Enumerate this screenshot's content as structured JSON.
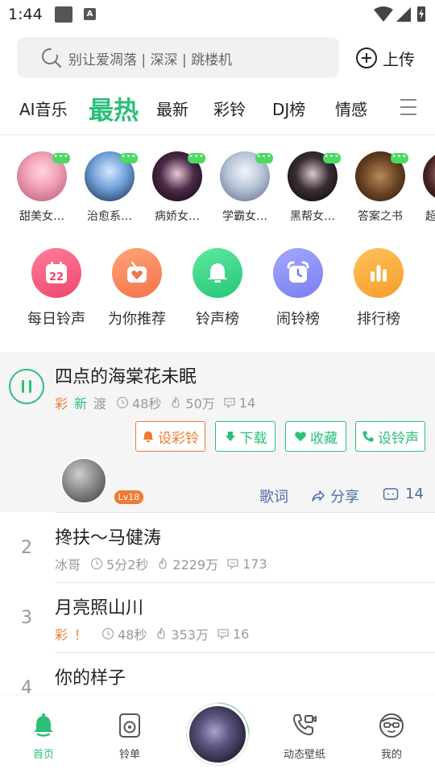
{
  "status_bar": {
    "time": "1:44",
    "a_label": "A"
  },
  "search": {
    "placeholder": "别让爱凋落 | 深深 | 跳楼机",
    "upload_label": "上传"
  },
  "tabs": [
    "AI音乐",
    "最热",
    "最新",
    "彩铃",
    "DJ榜",
    "情感"
  ],
  "active_tab": "最热",
  "avatars": [
    {
      "label": "甜美女…",
      "badge": "•••"
    },
    {
      "label": "治愈系…",
      "badge": "•••"
    },
    {
      "label": "病娇女…",
      "badge": "•••"
    },
    {
      "label": "学霸女…",
      "badge": "•••"
    },
    {
      "label": "黑帮女…",
      "badge": "•••"
    },
    {
      "label": "答案之书",
      "badge": "•••"
    },
    {
      "label": "超"
    }
  ],
  "categories": [
    {
      "label": "每日铃声",
      "icon": "calendar-icon",
      "color": "#f0567a",
      "number": "22"
    },
    {
      "label": "为你推荐",
      "icon": "heart-box-icon",
      "color": "#f6885a"
    },
    {
      "label": "铃声榜",
      "icon": "bell-icon",
      "color": "#3ed58a"
    },
    {
      "label": "闹铃榜",
      "icon": "alarm-clock-icon",
      "color": "#8b8df0"
    },
    {
      "label": "排行榜",
      "icon": "bar-chart-icon",
      "color": "#f7a93a"
    }
  ],
  "songs": [
    {
      "rank": "",
      "title": "四点的海棠花未眠",
      "tags": [
        {
          "text": "彩",
          "type": "orange"
        },
        {
          "text": "新",
          "type": "green"
        },
        {
          "text": "渡",
          "type": "gray"
        }
      ],
      "duration": "48秒",
      "plays": "50万",
      "comments": "14"
    },
    {
      "rank": "2",
      "title": "搀扶～马健涛",
      "artist": "冰哥",
      "duration": "5分2秒",
      "plays": "2229万",
      "comments": "173"
    },
    {
      "rank": "3",
      "title": "月亮照山川",
      "tags": [
        {
          "text": "彩",
          "type": "orange"
        },
        {
          "text": "！",
          "type": "orange"
        }
      ],
      "duration": "48秒",
      "plays": "353万",
      "comments": "16"
    },
    {
      "rank": "4",
      "title": "你的样子"
    }
  ],
  "actions": {
    "set_ringback": "设彩铃",
    "download": "下载",
    "favorite": "收藏",
    "set_ringtone": "设铃声"
  },
  "song_bar": {
    "level": "Lv18",
    "lyrics": "歌词",
    "share": "分享",
    "comment_count": "14"
  },
  "bottom_nav": {
    "home": "首页",
    "playlist": "铃单",
    "wallpaper": "动态壁纸",
    "me": "我的"
  },
  "colors": {
    "accent": "#2bbf7a",
    "orange": "#f07a32",
    "link": "#4a6fa5"
  }
}
